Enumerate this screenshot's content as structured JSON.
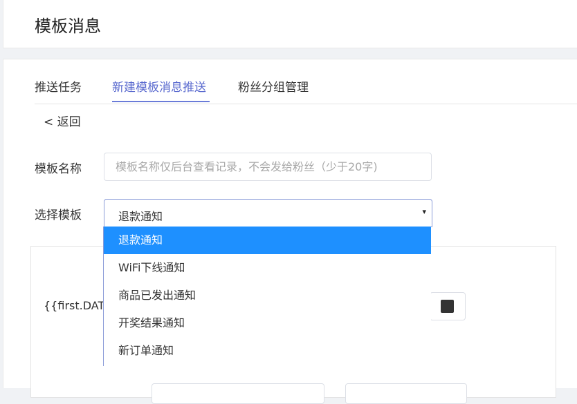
{
  "header": {
    "title": "模板消息"
  },
  "tabs": [
    {
      "label": "推送任务"
    },
    {
      "label": "新建模板消息推送"
    },
    {
      "label": "粉丝分组管理"
    }
  ],
  "back": {
    "label": "< 返回"
  },
  "form": {
    "template_name": {
      "label": "模板名称",
      "placeholder": "模板名称仅后台查看记录，不会发给粉丝（少于20字)",
      "value": ""
    },
    "template_select": {
      "label": "选择模板",
      "value": "退款通知",
      "caret": "▾",
      "options": [
        "退款通知",
        "WiFi下线通知",
        "商品已发出通知",
        "开奖结果通知",
        "新订单通知"
      ]
    }
  },
  "panel": {
    "variable_label": "{{first.DATA}}",
    "text_color": "#333333"
  },
  "colors": {
    "accent": "#5a6acf",
    "selected_option_bg": "#1e90ff"
  }
}
